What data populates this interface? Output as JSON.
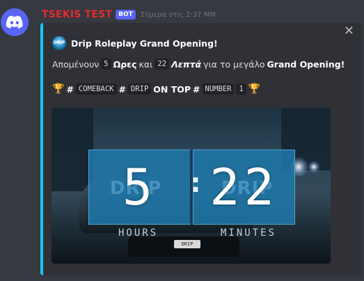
{
  "message": {
    "username": "TSEKIS TEST",
    "bot_tag": "BOT",
    "timestamp": "Σήμερα στις 2:37 ΜΜ"
  },
  "embed": {
    "accent_color": "#18c6f6",
    "close_label": "✕",
    "author_icon_text": "DRIP",
    "author_name": "Drip Roleplay Grand Opening!",
    "line1": {
      "prefix": "Απομένουν",
      "hours_value": "5",
      "hours_word": "Ωρες",
      "and": "και",
      "minutes_value": "22",
      "minutes_word": "Λεπτά",
      "middle": "για το μεγάλο",
      "suffix": "Grand Opening!"
    },
    "line2": {
      "trophy": "🏆",
      "tag1_hash": "#",
      "tag1": "COMEBACK",
      "tag2_hash": "#",
      "tag2": "DRIP",
      "on_top": "ON TOP",
      "tag3_hash": "#",
      "tag3": "NUMBER",
      "number": "1",
      "trophy_end": "🏆"
    },
    "image": {
      "hours_digits": "5",
      "minutes_digits": "22",
      "colon": ":",
      "hours_label": "HOURS",
      "minutes_label": "MINUTES",
      "watermark_left": "DRIP",
      "watermark_right": "DRIP",
      "plate_text": "DRIP"
    }
  },
  "colors": {
    "username": "#e32b2b",
    "bot_tag_bg": "#5865f2",
    "background": "#36393f",
    "embed_bg": "#2f3136"
  },
  "icons": {
    "avatar": "discord-logo-icon",
    "close": "close-icon"
  }
}
